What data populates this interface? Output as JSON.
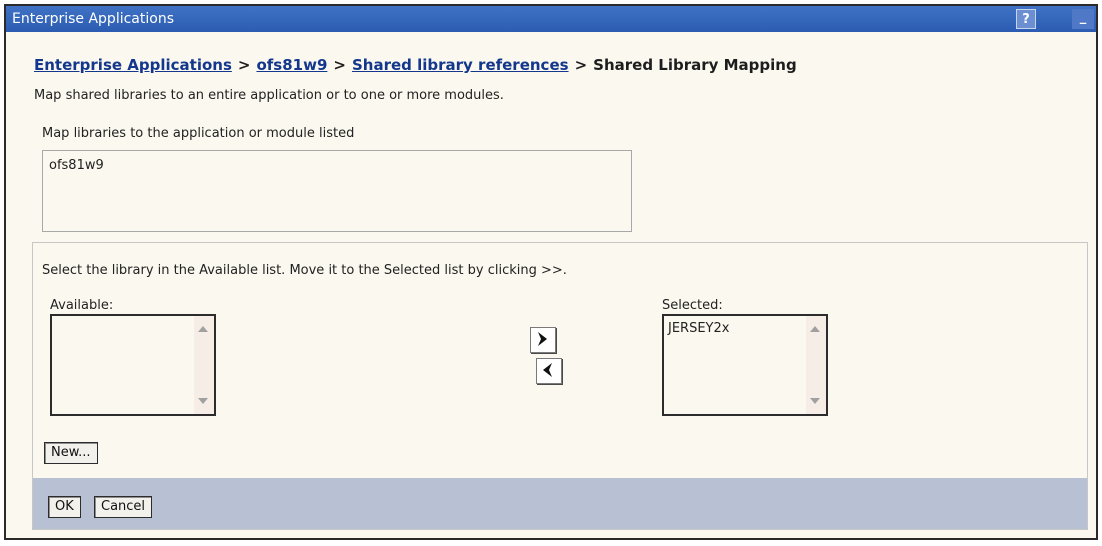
{
  "window": {
    "title": "Enterprise Applications",
    "help_label": "?",
    "minimize_label": "_"
  },
  "breadcrumb": {
    "items": [
      {
        "label": "Enterprise Applications"
      },
      {
        "label": "ofs81w9"
      },
      {
        "label": "Shared library references"
      }
    ],
    "current": "Shared Library Mapping",
    "separator": ">"
  },
  "description": "Map shared libraries to an entire application or to one or more modules.",
  "map_section": {
    "label": "Map libraries to the application or module listed",
    "app_name": "ofs81w9"
  },
  "library_panel": {
    "instruction": "Select the library in the Available list. Move it to the Selected list by clicking >>.",
    "available_label": "Available:",
    "available_items": [],
    "selected_label": "Selected:",
    "selected_items": [
      "JERSEY2x"
    ],
    "new_button": "New..."
  },
  "footer": {
    "ok_label": "OK",
    "cancel_label": "Cancel"
  },
  "colors": {
    "titlebar": "#2b5cb1",
    "link": "#13378c",
    "footer": "#b8c1d3",
    "background": "#fbf8ef"
  }
}
